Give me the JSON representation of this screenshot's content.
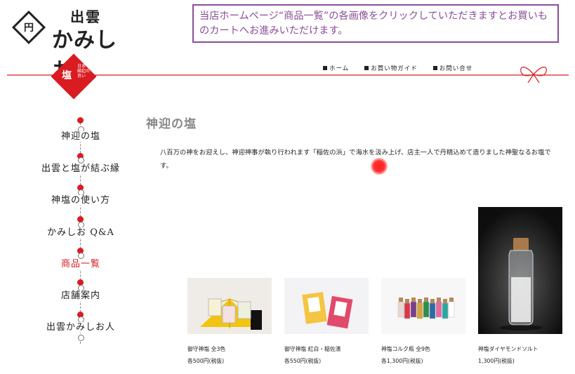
{
  "header": {
    "logo_mark": "円",
    "logo_top": "出雲",
    "logo_main": "かみしお",
    "notice": "当店ホームページ“商品一覧”の各画像をクリックしていただきますとお買いものカートへお進みいただけます。",
    "badge_big": "塩",
    "badge_small": "日本一縁起の良い",
    "nav": [
      {
        "label": "ホーム"
      },
      {
        "label": "お買い物ガイド"
      },
      {
        "label": "お問い合せ"
      }
    ],
    "accent_color": "#d91c22",
    "notice_color": "#8a4d9a"
  },
  "sidenav": {
    "items": [
      {
        "label": "神迎の塩",
        "active": false
      },
      {
        "label": "出雲と塩が結ぶ縁",
        "active": false
      },
      {
        "label": "神塩の使い方",
        "active": false
      },
      {
        "label": "かみしお Q&A",
        "active": false
      },
      {
        "label": "商品一覧",
        "active": true
      },
      {
        "label": "店舗案内",
        "active": false
      },
      {
        "label": "出雲かみしお人",
        "active": false
      }
    ]
  },
  "main": {
    "title": "神迎の塩",
    "description": "八百万の神をお迎えし、神迎神事が執り行われます「稲佐の浜」で海水を汲み上げ、店主一人で丹精込めて造りました神聖なるお塩です。",
    "products": [
      {
        "name": "御守神塩 全3色",
        "price": "各500円(税抜)",
        "image": "fan-packages"
      },
      {
        "name": "御守神塩 紅白・稲佐濱",
        "price": "各550円(税抜)",
        "image": "red-white-packages"
      },
      {
        "name": "神塩コルク瓶 全9色",
        "price": "各1,300円(税抜)",
        "image": "cork-bottles"
      },
      {
        "name": "神塩ダイヤモンドソルト",
        "price": "1,300円(税抜)",
        "image": "diamond-salt-bottle"
      }
    ]
  }
}
